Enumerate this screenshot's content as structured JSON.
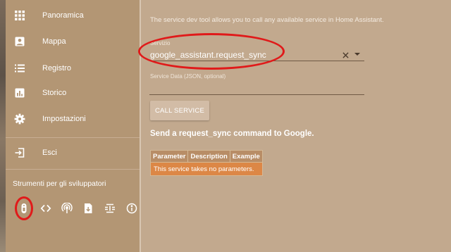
{
  "sidebar": {
    "items": [
      {
        "label": "Panoramica",
        "icon": "apps-grid-icon"
      },
      {
        "label": "Mappa",
        "icon": "account-box-icon"
      },
      {
        "label": "Registro",
        "icon": "list-icon"
      },
      {
        "label": "Storico",
        "icon": "bar-chart-icon"
      },
      {
        "label": "Impostazioni",
        "icon": "gear-icon"
      }
    ],
    "logout": {
      "label": "Esci",
      "icon": "exit-icon"
    },
    "dev_tools": {
      "title": "Strumenti per gli sviluppatori",
      "tools": [
        "remote-service-icon",
        "code-template-icon",
        "broadcast-event-icon",
        "state-file-icon",
        "mqtt-info-icon",
        "info-icon"
      ]
    }
  },
  "main": {
    "intro": "The service dev tool allows you to call any available service in Home Assistant.",
    "service_field": {
      "label": "Servizio",
      "value": "google_assistant.request_sync"
    },
    "service_data_field": {
      "label": "Service Data (JSON, optional)",
      "value": ""
    },
    "call_button": "CALL SERVICE",
    "service_description": "Send a request_sync command to Google.",
    "params_table": {
      "headers": [
        "Parameter",
        "Description",
        "Example"
      ],
      "empty_message": "This service takes no parameters."
    }
  },
  "colors": {
    "sidebar_bg": "#b39674",
    "main_bg": "#c2a98e",
    "highlight_ring": "#e01a1a",
    "table_header": "#b88d66",
    "table_empty_row": "#dc8746"
  }
}
